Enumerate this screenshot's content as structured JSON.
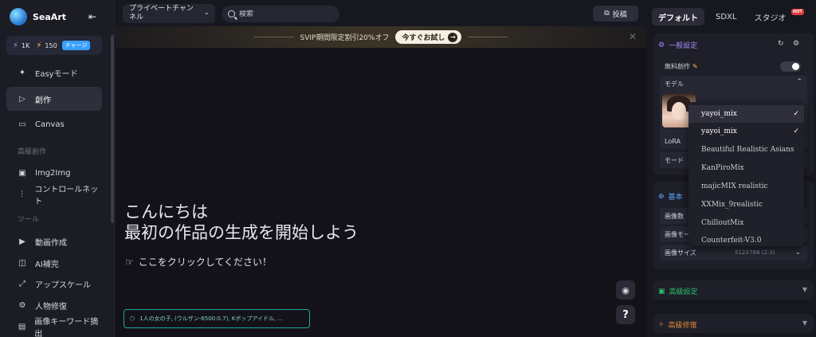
{
  "app": {
    "name": "SeaArt"
  },
  "credits": {
    "a": "1K",
    "b": "150",
    "charge": "チャージ"
  },
  "nav": {
    "easy": "Easyモード",
    "create": "創作",
    "canvas": "Canvas",
    "section_advanced": "高級創作",
    "img2img": "Img2Img",
    "controlnet": "コントロールネット",
    "section_tools": "ツール",
    "video": "動画作成",
    "ai_fill": "AI補完",
    "upscale": "アップスケール",
    "face_fix": "人物修復",
    "keywords": "画像キーワード摘出"
  },
  "topbar": {
    "channel": "プライベートチャンネル",
    "search_placeholder": "検索",
    "post": "投稿"
  },
  "banner": {
    "text": "SVIP期間限定割引20%オフ",
    "button": "今すぐお試し"
  },
  "main": {
    "line1": "こんにちは",
    "line2": "最初の作品の生成を開始しよう",
    "hint": "ここをクリックしてください！",
    "prompt_chip": "1人の女の子, (ウルザン-6500:0.7), Kポップアイドル, ..."
  },
  "right": {
    "tabs": [
      "デフォルト",
      "SDXL",
      "スタジオ"
    ],
    "hot": "HOT",
    "general": "一般設定",
    "free": "無料創作",
    "model": "モデル",
    "lora": "LoRA",
    "mode": "モード",
    "basic": "基本",
    "img_count": "画像数",
    "img_mode": "画像モー",
    "img_size": "画像サイズ",
    "img_size_value": "512X768 (2:3)",
    "advanced": "高級設定",
    "advanced_fix": "高級修復"
  },
  "model_dropdown": {
    "selected": "yayoi_mix",
    "options": [
      "yayoi_mix",
      "Beautiful Realistic Asians",
      "KanPiroMix",
      "majicMIX realistic",
      "XXMix_9realistic",
      "ChilloutMix",
      "Counterfeit-V3.0"
    ]
  },
  "colors": {
    "accent": "#3aa0ff",
    "teal": "#1aa89a",
    "purple": "#8b5cf6",
    "orange": "#e08a3c",
    "green": "#2fbf71"
  }
}
